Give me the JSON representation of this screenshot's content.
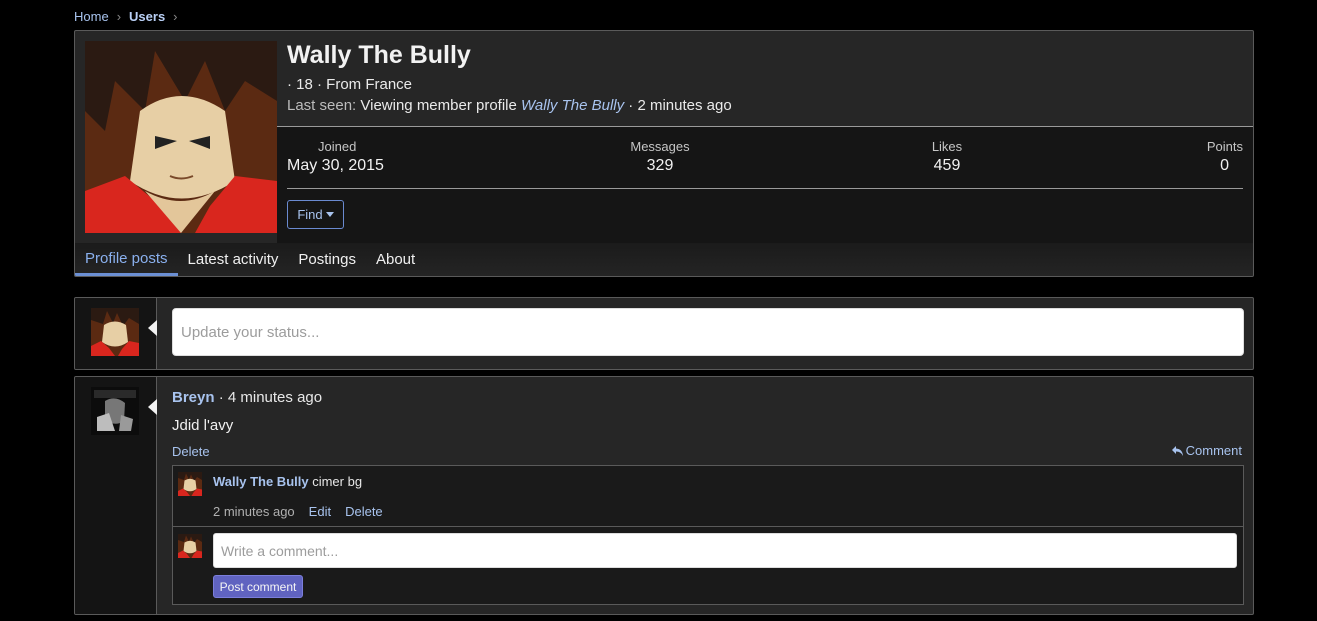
{
  "breadcrumb": {
    "home": "Home",
    "users": "Users",
    "sep": "›"
  },
  "profile": {
    "name": "Wally The Bully",
    "blurb": "· 18 · From France",
    "last_seen_label": "Last seen:",
    "last_seen_activity": "Viewing member profile",
    "last_seen_link": "Wally The Bully",
    "last_seen_time": "· 2 minutes ago",
    "stats": {
      "joined_label": "Joined",
      "joined_value": "May 30, 2015",
      "messages_label": "Messages",
      "messages_value": "329",
      "likes_label": "Likes",
      "likes_value": "459",
      "points_label": "Points",
      "points_value": "0"
    },
    "find_label": "Find",
    "tabs": [
      {
        "label": "Profile posts",
        "active": true
      },
      {
        "label": "Latest activity"
      },
      {
        "label": "Postings"
      },
      {
        "label": "About"
      }
    ]
  },
  "status": {
    "placeholder": "Update your status..."
  },
  "post": {
    "author": "Breyn",
    "time": "· 4 minutes ago",
    "body": "Jdid l'avy",
    "delete_label": "Delete",
    "comment_label": "Comment",
    "comments": [
      {
        "author": "Wally The Bully",
        "text": "cimer bg",
        "time": "2 minutes ago",
        "edit_label": "Edit",
        "delete_label": "Delete"
      }
    ],
    "reply": {
      "placeholder": "Write a comment...",
      "button_label": "Post comment"
    }
  },
  "colors": {
    "link": "#a8c3ee",
    "accent": "#6b8fd4",
    "button": "#6063c0",
    "avatar_red": "#d9261e"
  },
  "icons": {
    "reply": "reply-arrow-icon",
    "caret": "caret-down-icon"
  }
}
